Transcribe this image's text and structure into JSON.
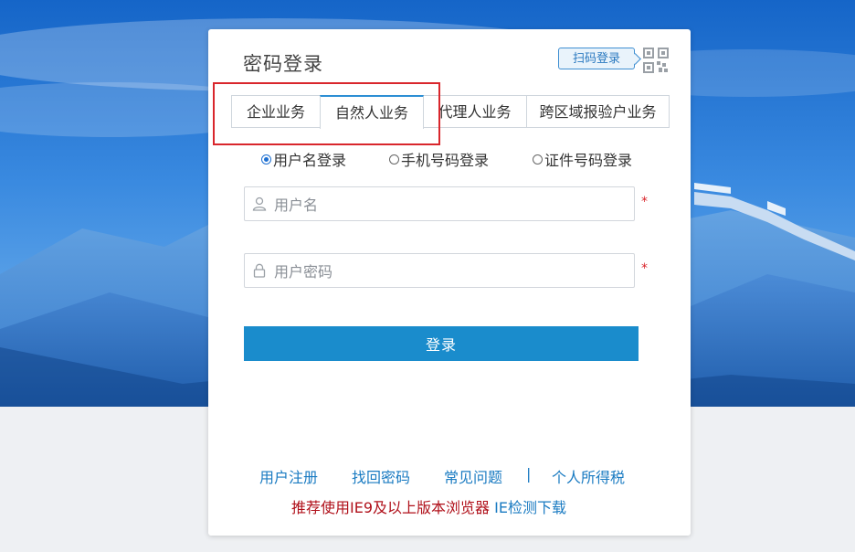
{
  "card": {
    "title": "密码登录",
    "qr_tip": "扫码登录",
    "qr_icon": "qr-code-icon"
  },
  "tabs": [
    {
      "label": "企业业务",
      "active": false
    },
    {
      "label": "自然人业务",
      "active": true
    },
    {
      "label": "代理人业务",
      "active": false
    },
    {
      "label": "跨区域报验户业务",
      "active": false
    }
  ],
  "login_modes": [
    {
      "label": "用户名登录",
      "checked": true
    },
    {
      "label": "手机号码登录",
      "checked": false
    },
    {
      "label": "证件号码登录",
      "checked": false
    }
  ],
  "form": {
    "username": {
      "placeholder": "用户名",
      "value": "",
      "icon": "user-icon",
      "required_mark": "*"
    },
    "password": {
      "placeholder": "用户密码",
      "value": "",
      "icon": "lock-icon",
      "required_mark": "*"
    },
    "submit_label": "登录"
  },
  "footer": {
    "links": [
      "用户注册",
      "找回密码",
      "常见问题",
      "个人所得税"
    ],
    "separator": "|",
    "notice": "推荐使用IE9及以上版本浏览器",
    "ie_link": "IE检测下载"
  },
  "colors": {
    "accent": "#1a8ccc",
    "tab_active_border": "#2c8fd4",
    "highlight_box": "#d9262c",
    "link": "#1a7bc2",
    "notice": "#b0101a"
  }
}
